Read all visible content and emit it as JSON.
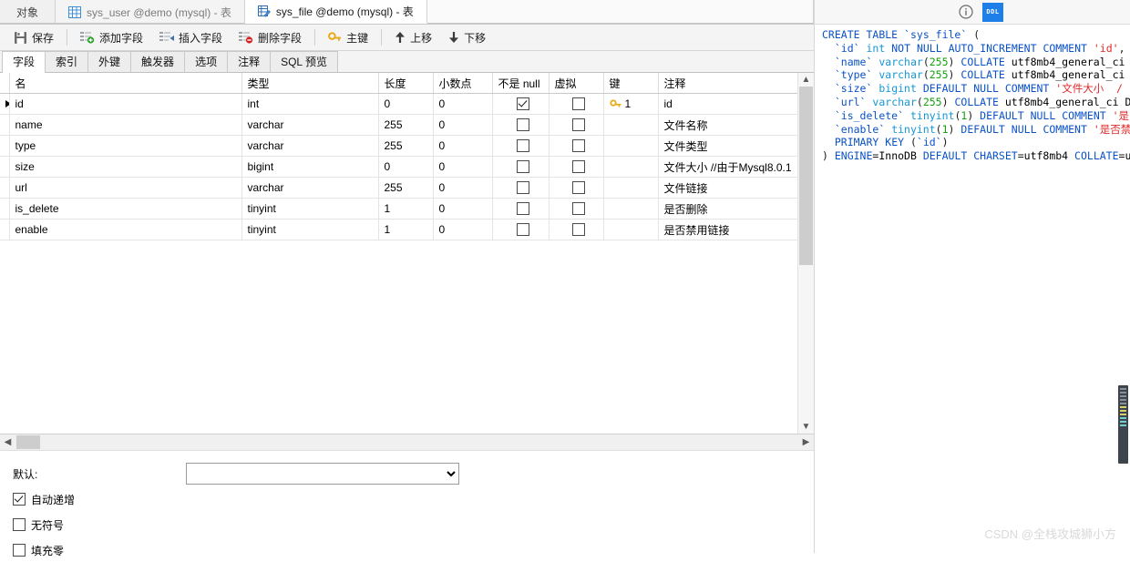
{
  "window_tabs": [
    {
      "label": "对象",
      "icon": "",
      "state": "plain"
    },
    {
      "label": "sys_user @demo (mysql) - 表",
      "icon": "table-icon",
      "state": "inactive"
    },
    {
      "label": "sys_file @demo (mysql) - 表",
      "icon": "table-edit-icon",
      "state": "active"
    }
  ],
  "header_icons": {
    "info": "info-icon",
    "ddl": "DDL"
  },
  "toolbar": {
    "save": "保存",
    "add_field": "添加字段",
    "insert_field": "插入字段",
    "delete_field": "删除字段",
    "primary_key": "主键",
    "move_up": "上移",
    "move_down": "下移"
  },
  "inner_tabs": [
    {
      "label": "字段",
      "active": true
    },
    {
      "label": "索引",
      "active": false
    },
    {
      "label": "外键",
      "active": false
    },
    {
      "label": "触发器",
      "active": false
    },
    {
      "label": "选项",
      "active": false
    },
    {
      "label": "注释",
      "active": false
    },
    {
      "label": "SQL 预览",
      "active": false
    }
  ],
  "grid": {
    "columns": [
      "名",
      "类型",
      "长度",
      "小数点",
      "不是 null",
      "虚拟",
      "键",
      "注释"
    ],
    "rows": [
      {
        "selected": true,
        "name": "id",
        "type": "int",
        "length": "0",
        "decimals": "0",
        "notnull": true,
        "virtual": false,
        "key": "1",
        "comment": "id"
      },
      {
        "selected": false,
        "name": "name",
        "type": "varchar",
        "length": "255",
        "decimals": "0",
        "notnull": false,
        "virtual": false,
        "key": "",
        "comment": "文件名称"
      },
      {
        "selected": false,
        "name": "type",
        "type": "varchar",
        "length": "255",
        "decimals": "0",
        "notnull": false,
        "virtual": false,
        "key": "",
        "comment": "文件类型"
      },
      {
        "selected": false,
        "name": "size",
        "type": "bigint",
        "length": "0",
        "decimals": "0",
        "notnull": false,
        "virtual": false,
        "key": "",
        "comment": "文件大小  //由于Mysql8.0.1"
      },
      {
        "selected": false,
        "name": "url",
        "type": "varchar",
        "length": "255",
        "decimals": "0",
        "notnull": false,
        "virtual": false,
        "key": "",
        "comment": "文件链接"
      },
      {
        "selected": false,
        "name": "is_delete",
        "type": "tinyint",
        "length": "1",
        "decimals": "0",
        "notnull": false,
        "virtual": false,
        "key": "",
        "comment": "是否删除"
      },
      {
        "selected": false,
        "name": "enable",
        "type": "tinyint",
        "length": "1",
        "decimals": "0",
        "notnull": false,
        "virtual": false,
        "key": "",
        "comment": "是否禁用链接"
      }
    ]
  },
  "properties": {
    "default_label": "默认:",
    "default_value": "",
    "auto_increment": {
      "label": "自动递增",
      "checked": true
    },
    "unsigned": {
      "label": "无符号",
      "checked": false
    },
    "zerofill": {
      "label": "填充零",
      "checked": false
    }
  },
  "ddl": {
    "lines": [
      "CREATE TABLE `sys_file` (",
      "  `id` int NOT NULL AUTO_INCREMENT COMMENT 'id',",
      "  `name` varchar(255) COLLATE utf8mb4_general_ci",
      "  `type` varchar(255) COLLATE utf8mb4_general_ci",
      "  `size` bigint DEFAULT NULL COMMENT '文件大小  /",
      "  `url` varchar(255) COLLATE utf8mb4_general_ci D",
      "  `is_delete` tinyint(1) DEFAULT NULL COMMENT '是",
      "  `enable` tinyint(1) DEFAULT NULL COMMENT '是否禁",
      "  PRIMARY KEY (`id`)",
      ") ENGINE=InnoDB DEFAULT CHARSET=utf8mb4 COLLATE=u"
    ]
  },
  "watermark": "CSDN @全栈攻城狮小方",
  "colors": {
    "accent": "#1e7fe8",
    "keyword": "#0a52c8",
    "type": "#1596d6",
    "number": "#13a10e",
    "string": "#e02828",
    "key_icon": "#e8ab17"
  }
}
